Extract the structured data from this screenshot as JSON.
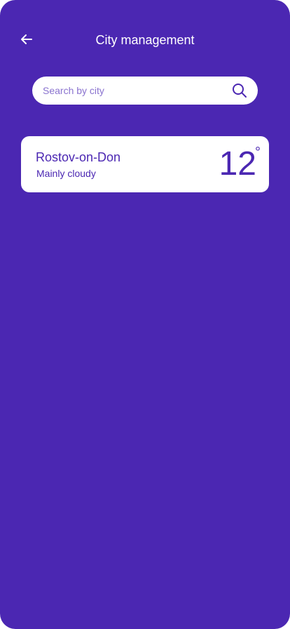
{
  "header": {
    "back_icon": "arrow-left-icon",
    "title": "City management"
  },
  "search": {
    "placeholder": "Search by city",
    "value": "",
    "icon": "search-icon"
  },
  "cities": [
    {
      "name": "Rostov-on-Don",
      "condition": "Mainly cloudy",
      "temperature": "12",
      "degree_symbol": "°"
    }
  ],
  "colors": {
    "background": "#4B27B2",
    "card": "#FFFFFF",
    "accent": "#4B27B2",
    "placeholder": "#8A73CF"
  }
}
